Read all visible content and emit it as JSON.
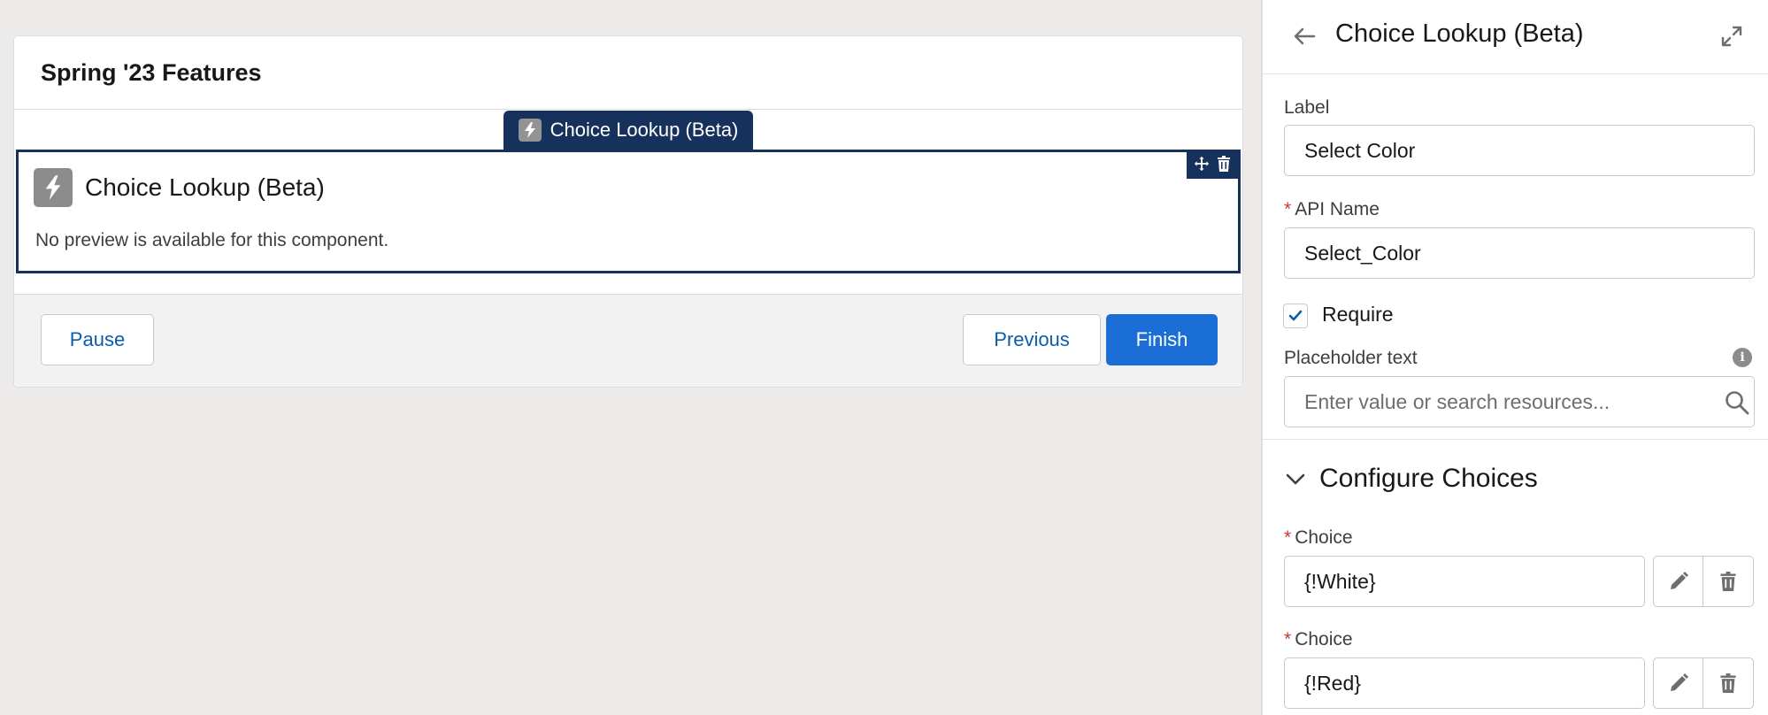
{
  "screen": {
    "title": "Spring '23 Features",
    "component_tab_label": "Choice Lookup (Beta)",
    "component": {
      "title": "Choice Lookup (Beta)",
      "preview_note": "No preview is available for this component."
    },
    "footer": {
      "pause_label": "Pause",
      "previous_label": "Previous",
      "finish_label": "Finish"
    }
  },
  "panel": {
    "title": "Choice Lookup (Beta)",
    "fields": {
      "label": {
        "label": "Label",
        "value": "Select Color"
      },
      "api_name": {
        "label": "API Name",
        "value": "Select_Color",
        "required_mark": "*"
      },
      "require": {
        "label": "Require",
        "checked": true
      },
      "placeholder": {
        "label": "Placeholder text",
        "placeholder": "Enter value or search resources..."
      }
    },
    "section": {
      "title": "Configure Choices",
      "choices": [
        {
          "label": "Choice",
          "value": "{!White}",
          "required_mark": "*"
        },
        {
          "label": "Choice",
          "value": "{!Red}",
          "required_mark": "*"
        }
      ]
    }
  },
  "colors": {
    "brand": "#1b6ed6",
    "selected_component": "#16325c",
    "required": "#c23934"
  }
}
